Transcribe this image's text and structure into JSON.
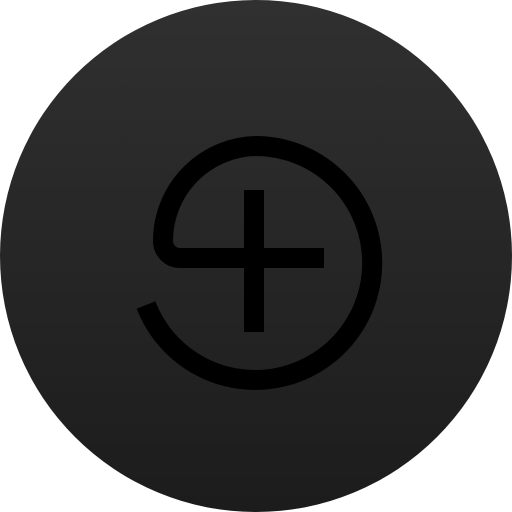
{
  "icon": {
    "name": "app-icon",
    "glyph": "looped-plus-mark",
    "colors": {
      "disc_top": "#303030",
      "disc_bottom": "#1c1c1c",
      "mark": "#000000"
    }
  }
}
